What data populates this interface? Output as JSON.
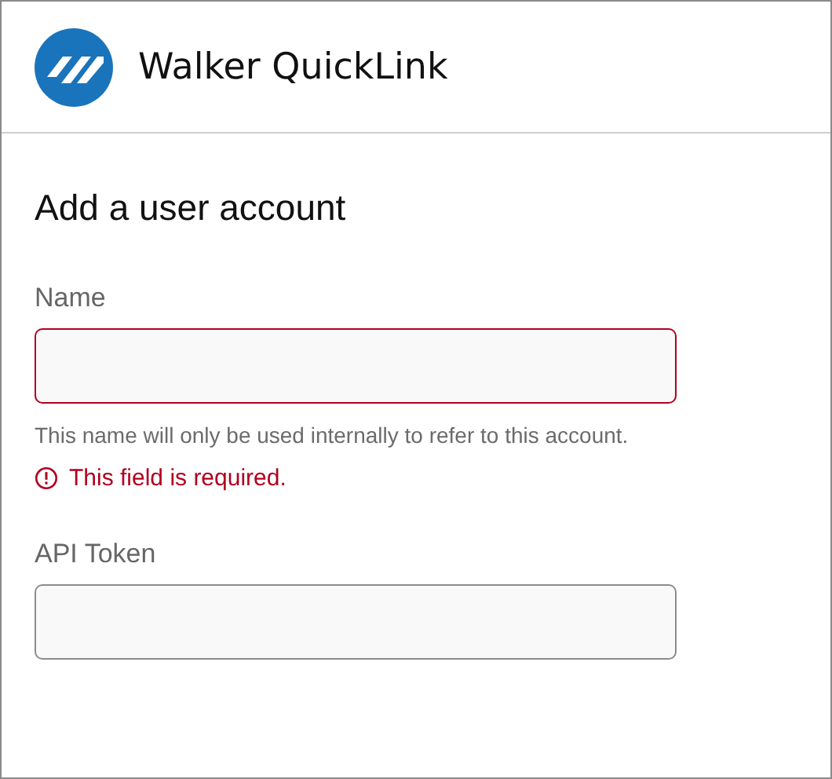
{
  "header": {
    "title": "Walker QuickLink"
  },
  "form": {
    "heading": "Add a user account",
    "fields": [
      {
        "label": "Name",
        "invalid": true,
        "help": "This name will only be used internally to refer to this account.",
        "error": "This field is required."
      },
      {
        "label": "API Token",
        "invalid": false
      }
    ]
  }
}
